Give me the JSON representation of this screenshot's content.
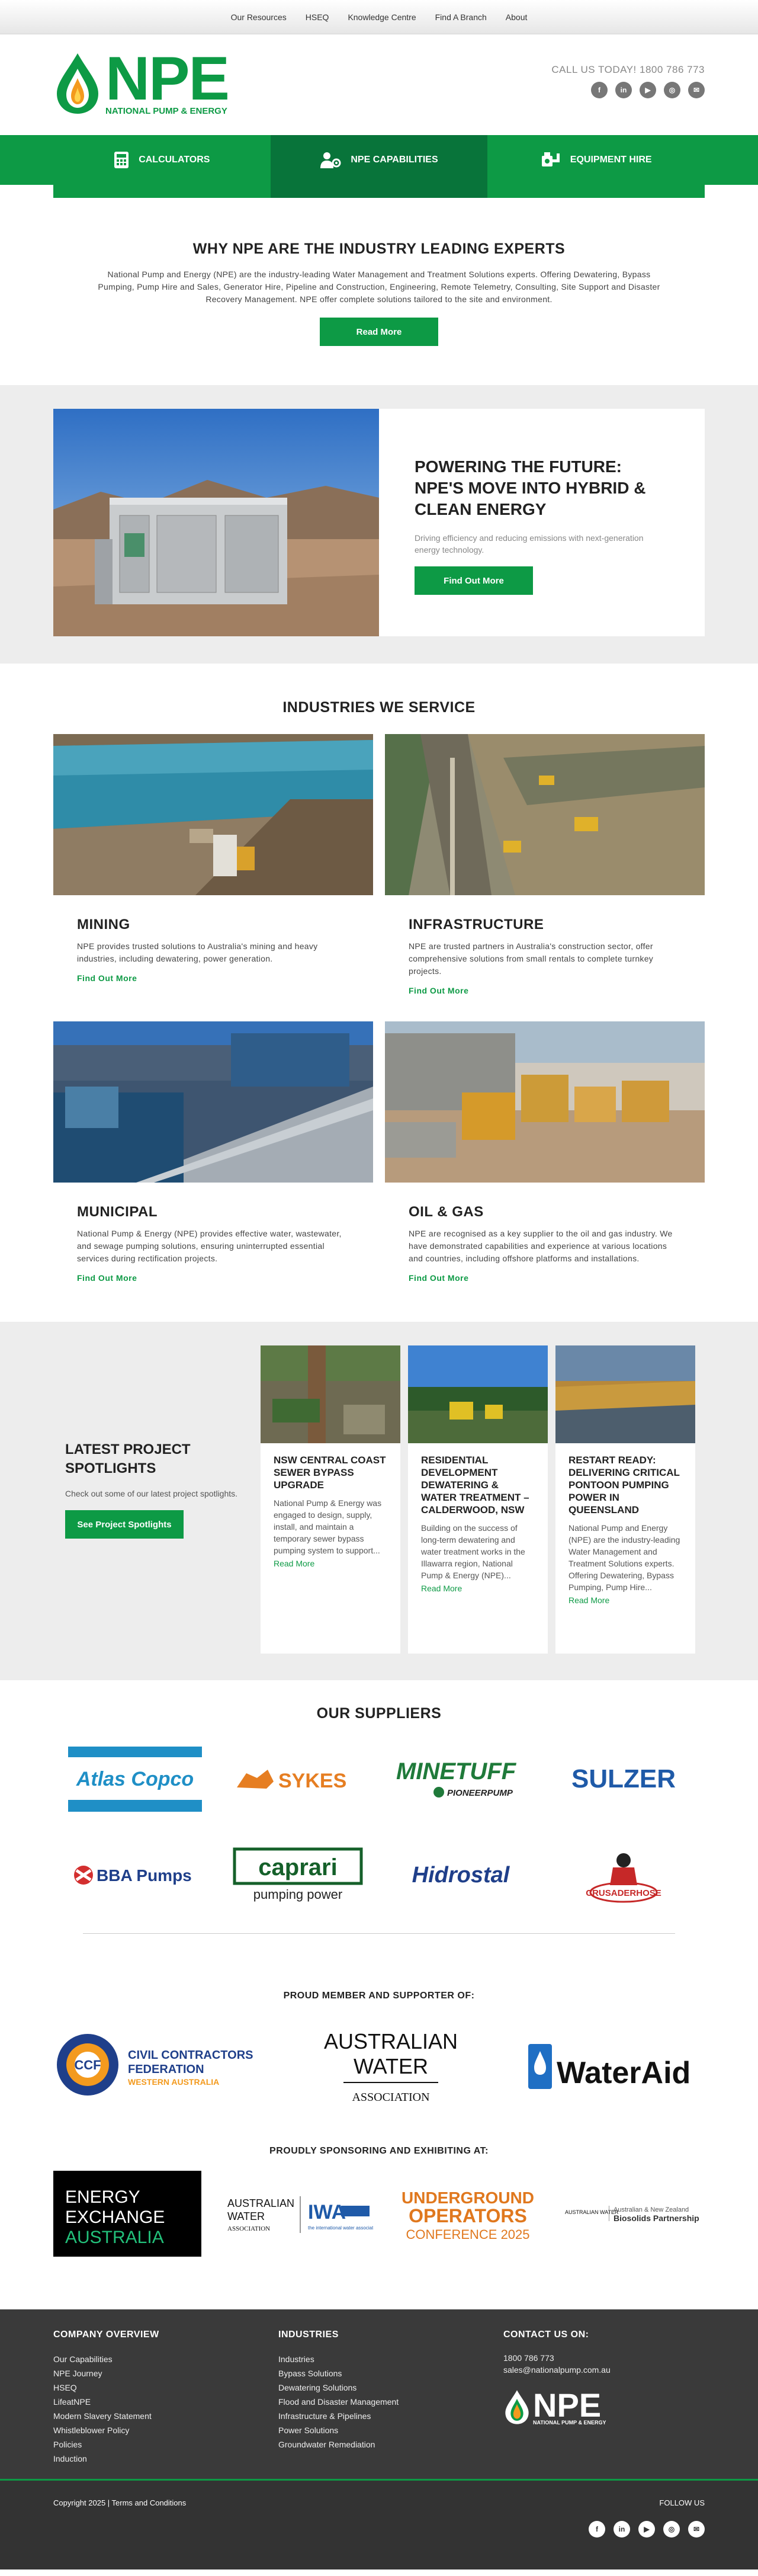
{
  "topnav": [
    "Our Resources",
    "HSEQ",
    "Knowledge Centre",
    "Find A Branch",
    "About"
  ],
  "logo": {
    "name": "NPE",
    "subtitle": "NATIONAL PUMP & ENERGY"
  },
  "callus": "CALL US TODAY! 1800 786 773",
  "socials": [
    "facebook-icon",
    "linkedin-icon",
    "youtube-icon",
    "instagram-icon",
    "email-icon"
  ],
  "mainnav": [
    {
      "label": "CALCULATORS",
      "icon": "calculator-icon"
    },
    {
      "label": "NPE CAPABILITIES",
      "icon": "people-gear-icon"
    },
    {
      "label": "EQUIPMENT HIRE",
      "icon": "pump-icon"
    }
  ],
  "why": {
    "title": "WHY NPE ARE THE INDUSTRY LEADING EXPERTS",
    "body": "National Pump and Energy (NPE) are the industry-leading Water Management and Treatment Solutions experts. Offering Dewatering, Bypass Pumping, Pump Hire and Sales, Generator Hire, Pipeline and Construction, Engineering, Remote Telemetry, Consulting, Site Support and Disaster Recovery Management. NPE offer complete solutions tailored to the site and environment.",
    "button": "Read More"
  },
  "power": {
    "title": "POWERING THE FUTURE: NPE'S MOVE INTO HYBRID & CLEAN ENERGY",
    "body": "Driving efficiency and reducing emissions with next-generation energy technology.",
    "button": "Find Out More"
  },
  "industries": {
    "title": "INDUSTRIES WE SERVICE",
    "items": [
      {
        "name": "MINING",
        "body": "NPE provides trusted solutions to Australia's mining and heavy industries, including dewatering, power generation.",
        "link": "Find Out More"
      },
      {
        "name": "INFRASTRUCTURE",
        "body": "NPE are trusted partners in Australia's construction sector, offer comprehensive solutions from small rentals to complete turnkey projects.",
        "link": "Find Out More"
      },
      {
        "name": "MUNICIPAL",
        "body": "National Pump & Energy (NPE) provides effective water, wastewater, and sewage pumping solutions, ensuring uninterrupted essential services during rectification projects.",
        "link": "Find Out More"
      },
      {
        "name": "OIL & GAS",
        "body": "NPE are recognised as a key supplier to the oil and gas industry. We have demonstrated capabilities and experience at various locations and countries, including offshore platforms and installations.",
        "link": "Find Out More"
      }
    ]
  },
  "projects": {
    "title": "LATEST PROJECT SPOTLIGHTS",
    "body": "Check out some of our latest project spotlights.",
    "button": "See Project Spotlights",
    "cards": [
      {
        "title": "NSW CENTRAL COAST SEWER BYPASS UPGRADE",
        "body": "National Pump & Energy was engaged to design, supply, install, and maintain a temporary sewer bypass pumping system to support...",
        "link": "Read More"
      },
      {
        "title": "RESIDENTIAL DEVELOPMENT DEWATERING & WATER TREATMENT – CALDERWOOD, NSW",
        "body": "Building on the success of long-term dewatering and water treatment works in the Illawarra region, National Pump & Energy (NPE)...",
        "link": "Read More"
      },
      {
        "title": "RESTART READY: DELIVERING CRITICAL PONTOON PUMPING POWER IN QUEENSLAND",
        "body": "National Pump and Energy (NPE) are the industry-leading Water Management and Treatment Solutions experts. Offering Dewatering, Bypass Pumping, Pump Hire...",
        "link": "Read More"
      }
    ]
  },
  "suppliers": {
    "title": "OUR SUPPLIERS",
    "logos": {
      "atlas": "Atlas Copco",
      "sykes": "SYKES",
      "minetuff": "MINETUFF",
      "pioneer": "PIONEERPUMP",
      "sulzer": "SULZER",
      "bba": "BBA Pumps",
      "caprari": "caprari",
      "caprari_sub": "pumping power",
      "hidrostal": "Hidrostal",
      "crusader": "CRUSADERHOSE"
    }
  },
  "proud": {
    "title": "PROUD MEMBER AND SUPPORTER OF:",
    "ccf": {
      "short": "CCF",
      "line1": "CIVIL CONTRACTORS",
      "line2": "FEDERATION",
      "line3": "WESTERN AUSTRALIA"
    },
    "awa": {
      "line1": "AUSTRALIAN",
      "line2": "WATER",
      "line3": "ASSOCIATION"
    },
    "wateraid": "WaterAid"
  },
  "sponsor": {
    "title": "PROUDLY SPONSORING AND EXHIBITING AT:",
    "ea": [
      "ENERGY",
      "EXCHANGE",
      "AUSTRALIA"
    ],
    "awa_iwa": {
      "awa1": "AUSTRALIAN",
      "awa2": "WATER",
      "awa3": "ASSOCIATION",
      "iwa": "IWA",
      "iwa_sub": "the international water association"
    },
    "uo": [
      "UNDERGROUND",
      "OPERATORS",
      "CONFERENCE 2025"
    ],
    "biosolids": {
      "awa": "AUSTRALIAN WATER",
      "line1": "Australian & New Zealand",
      "line2": "Biosolids Partnership"
    }
  },
  "footer": {
    "company": {
      "title": "COMPANY OVERVIEW",
      "links": [
        "Our Capabilities",
        "NPE Journey",
        "HSEQ",
        "LifeatNPE",
        "Modern Slavery Statement",
        "Whistleblower Policy",
        "Policies",
        "Induction"
      ]
    },
    "industries": {
      "title": "INDUSTRIES",
      "links": [
        "Industries",
        "Bypass Solutions",
        "Dewatering Solutions",
        "Flood and Disaster Management",
        "Infrastructure & Pipelines",
        "Power Solutions",
        "Groundwater Remediation"
      ]
    },
    "contact": {
      "title": "CONTACT US ON:",
      "phone": "1800 786 773",
      "email": "sales@nationalpump.com.au"
    },
    "copyright": "Copyright 2025 | Terms and Conditions",
    "follow": "FOLLOW US"
  }
}
